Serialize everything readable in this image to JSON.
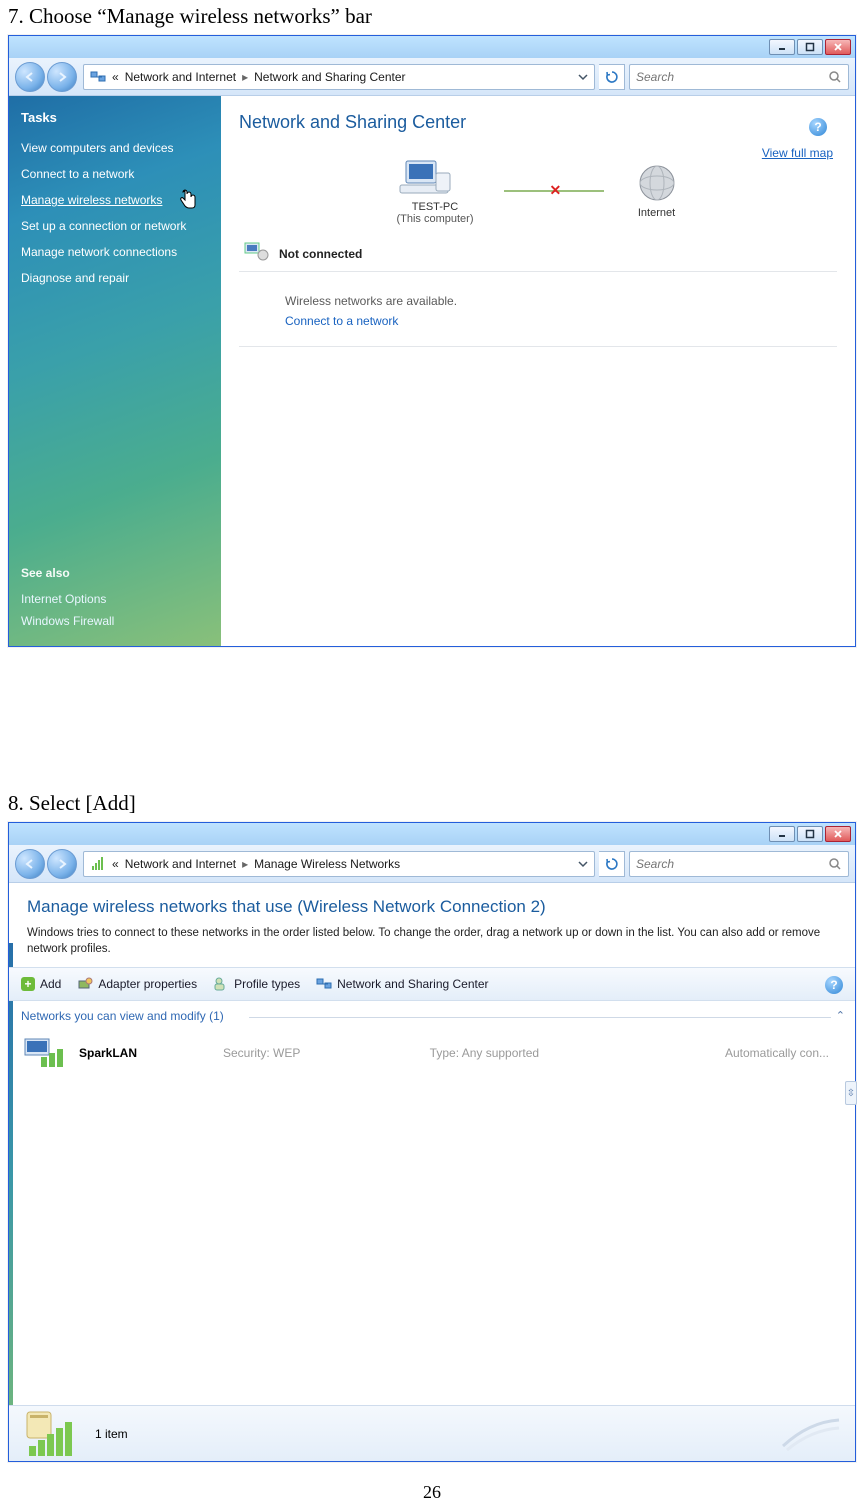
{
  "doc": {
    "step7": "7. Choose “Manage wireless networks” bar",
    "step8": "8. Select [Add]",
    "pagenum": "26"
  },
  "win1": {
    "breadcrumb": {
      "prefix_icon": "chevrons",
      "seg1": "Network and Internet",
      "seg2": "Network and Sharing Center"
    },
    "search_placeholder": "Search",
    "tasks_title": "Tasks",
    "tasks": [
      "View computers and devices",
      "Connect to a network",
      "Manage wireless networks",
      "Set up a connection or network",
      "Manage network connections",
      "Diagnose and repair"
    ],
    "see_also_title": "See also",
    "see_also": [
      "Internet Options",
      "Windows Firewall"
    ],
    "page_title": "Network and Sharing Center",
    "view_full_map": "View full map",
    "node1": "TEST-PC",
    "node1_sub": "(This computer)",
    "node2": "Internet",
    "not_connected": "Not connected",
    "wireless_msg": "Wireless networks are available.",
    "connect_link": "Connect to a network"
  },
  "win2": {
    "breadcrumb": {
      "seg1": "Network and Internet",
      "seg2": "Manage Wireless Networks"
    },
    "search_placeholder": "Search",
    "title": "Manage wireless networks that use (Wireless Network Connection 2)",
    "desc": "Windows tries to connect to these networks in the order listed below. To change the order, drag a network up or down in the list. You can also add or remove network profiles.",
    "toolbar": {
      "add": "Add",
      "adapter": "Adapter properties",
      "profile": "Profile types",
      "nsc": "Network and Sharing Center"
    },
    "group_header": "Networks you can view and modify (1)",
    "row": {
      "name": "SparkLAN",
      "security": "Security:  WEP",
      "type": "Type:  Any supported",
      "auto": "Automatically con..."
    },
    "status": "1 item"
  }
}
